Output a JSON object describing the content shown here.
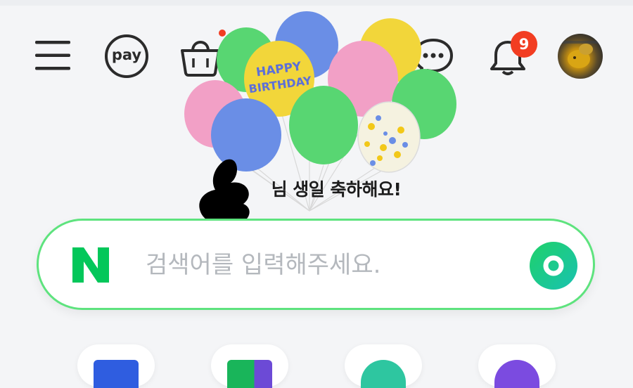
{
  "header": {
    "menu_icon": "hamburger-menu-icon",
    "pay_label": "pay",
    "cart_icon": "shopping-bag-icon",
    "chat_icon": "chat-bubble-icon",
    "notifications": {
      "icon": "bell-icon",
      "count": "9"
    },
    "avatar": "profile-avatar"
  },
  "banner": {
    "greeting": "님 생일 축하해요!",
    "balloon_text_line1": "HAPPY",
    "balloon_text_line2": "BIRTHDAY"
  },
  "search": {
    "logo": "N",
    "placeholder": "검색어를 입력해주세요."
  },
  "shortcuts": [
    {
      "name": "shortcut-1",
      "color": "#2f5de0"
    },
    {
      "name": "shortcut-2",
      "color": "#19b55a"
    },
    {
      "name": "shortcut-3",
      "color": "#2ec6a0"
    },
    {
      "name": "shortcut-4",
      "color": "#7b4be0"
    }
  ],
  "colors": {
    "naver_green": "#03c75a",
    "search_border": "#5ee37e",
    "badge_red": "#f23d22"
  }
}
